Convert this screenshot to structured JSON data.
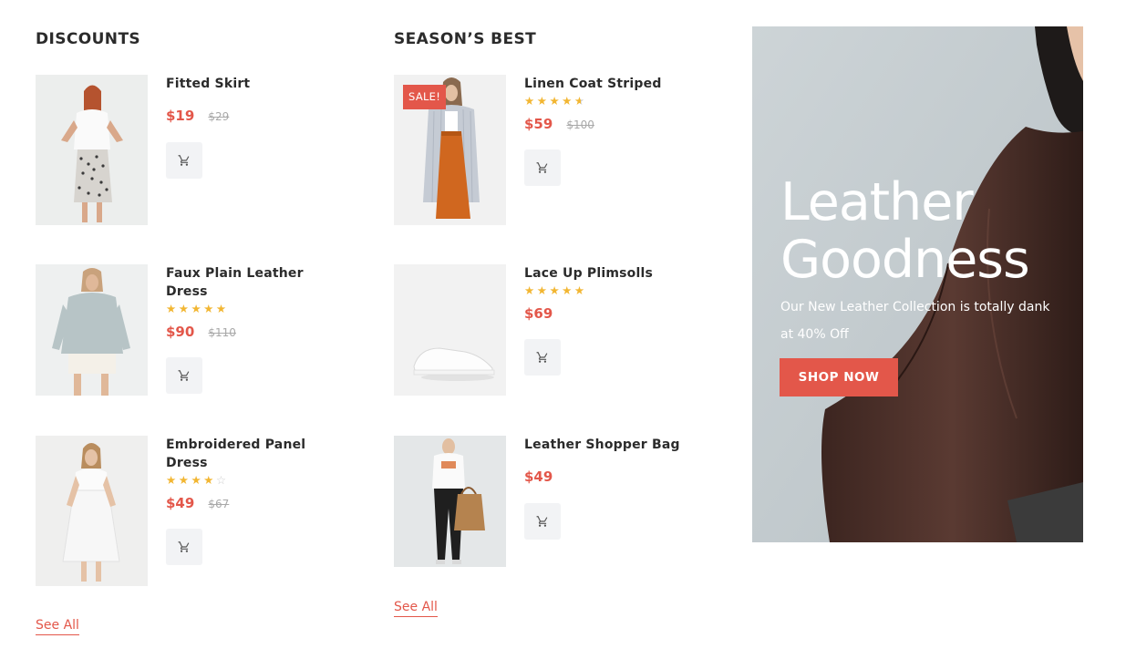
{
  "discounts": {
    "title": "DISCOUNTS",
    "see_all": "See All",
    "products": [
      {
        "name": "Fitted Skirt",
        "price": "$19",
        "old_price": "$29",
        "rating": null
      },
      {
        "name": "Faux Plain Leather Dress",
        "price": "$90",
        "old_price": "$110",
        "rating": 5
      },
      {
        "name": "Embroidered Panel Dress",
        "price": "$49",
        "old_price": "$67",
        "rating": 4
      }
    ]
  },
  "seasons_best": {
    "title": "SEASON’S BEST",
    "see_all": "See All",
    "products": [
      {
        "name": "Linen Coat Striped",
        "price": "$59",
        "old_price": "$100",
        "rating": 4.5,
        "badge": "SALE!"
      },
      {
        "name": "Lace Up Plimsolls",
        "price": "$69",
        "old_price": null,
        "rating": 5
      },
      {
        "name": "Leather Shopper Bag",
        "price": "$49",
        "old_price": null,
        "rating": null
      }
    ]
  },
  "banner": {
    "title_line1": "Leather",
    "title_line2": "Goodness",
    "subtitle": "Our New Leather Collection is totally dank at 40% Off",
    "cta": "SHOP NOW"
  },
  "icons": {
    "cart": "cart-icon",
    "star": "star-icon"
  },
  "colors": {
    "accent": "#e3574a",
    "star": "#f2b632",
    "text": "#2b2b2b",
    "muted": "#a9a9a9",
    "button_bg": "#f2f3f5"
  }
}
